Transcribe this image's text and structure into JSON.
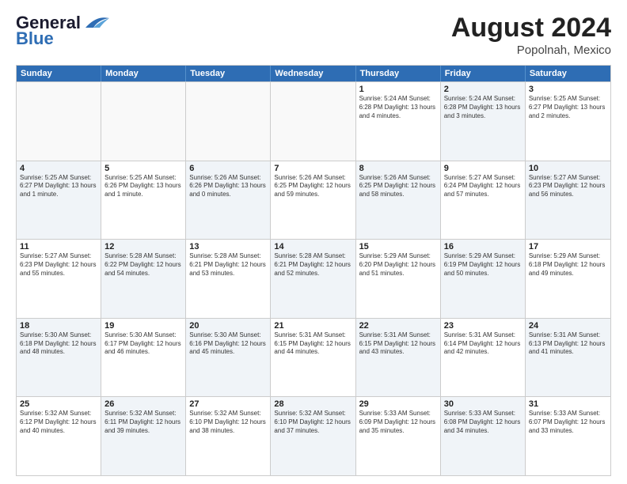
{
  "header": {
    "logo_general": "General",
    "logo_blue": "Blue",
    "month_year": "August 2024",
    "location": "Popolnah, Mexico"
  },
  "weekdays": [
    "Sunday",
    "Monday",
    "Tuesday",
    "Wednesday",
    "Thursday",
    "Friday",
    "Saturday"
  ],
  "rows": [
    [
      {
        "day": "",
        "info": "",
        "shaded": false,
        "empty": true
      },
      {
        "day": "",
        "info": "",
        "shaded": false,
        "empty": true
      },
      {
        "day": "",
        "info": "",
        "shaded": false,
        "empty": true
      },
      {
        "day": "",
        "info": "",
        "shaded": false,
        "empty": true
      },
      {
        "day": "1",
        "info": "Sunrise: 5:24 AM\nSunset: 6:28 PM\nDaylight: 13 hours\nand 4 minutes.",
        "shaded": false,
        "empty": false
      },
      {
        "day": "2",
        "info": "Sunrise: 5:24 AM\nSunset: 6:28 PM\nDaylight: 13 hours\nand 3 minutes.",
        "shaded": true,
        "empty": false
      },
      {
        "day": "3",
        "info": "Sunrise: 5:25 AM\nSunset: 6:27 PM\nDaylight: 13 hours\nand 2 minutes.",
        "shaded": false,
        "empty": false
      }
    ],
    [
      {
        "day": "4",
        "info": "Sunrise: 5:25 AM\nSunset: 6:27 PM\nDaylight: 13 hours\nand 1 minute.",
        "shaded": true,
        "empty": false
      },
      {
        "day": "5",
        "info": "Sunrise: 5:25 AM\nSunset: 6:26 PM\nDaylight: 13 hours\nand 1 minute.",
        "shaded": false,
        "empty": false
      },
      {
        "day": "6",
        "info": "Sunrise: 5:26 AM\nSunset: 6:26 PM\nDaylight: 13 hours\nand 0 minutes.",
        "shaded": true,
        "empty": false
      },
      {
        "day": "7",
        "info": "Sunrise: 5:26 AM\nSunset: 6:25 PM\nDaylight: 12 hours\nand 59 minutes.",
        "shaded": false,
        "empty": false
      },
      {
        "day": "8",
        "info": "Sunrise: 5:26 AM\nSunset: 6:25 PM\nDaylight: 12 hours\nand 58 minutes.",
        "shaded": true,
        "empty": false
      },
      {
        "day": "9",
        "info": "Sunrise: 5:27 AM\nSunset: 6:24 PM\nDaylight: 12 hours\nand 57 minutes.",
        "shaded": false,
        "empty": false
      },
      {
        "day": "10",
        "info": "Sunrise: 5:27 AM\nSunset: 6:23 PM\nDaylight: 12 hours\nand 56 minutes.",
        "shaded": true,
        "empty": false
      }
    ],
    [
      {
        "day": "11",
        "info": "Sunrise: 5:27 AM\nSunset: 6:23 PM\nDaylight: 12 hours\nand 55 minutes.",
        "shaded": false,
        "empty": false
      },
      {
        "day": "12",
        "info": "Sunrise: 5:28 AM\nSunset: 6:22 PM\nDaylight: 12 hours\nand 54 minutes.",
        "shaded": true,
        "empty": false
      },
      {
        "day": "13",
        "info": "Sunrise: 5:28 AM\nSunset: 6:21 PM\nDaylight: 12 hours\nand 53 minutes.",
        "shaded": false,
        "empty": false
      },
      {
        "day": "14",
        "info": "Sunrise: 5:28 AM\nSunset: 6:21 PM\nDaylight: 12 hours\nand 52 minutes.",
        "shaded": true,
        "empty": false
      },
      {
        "day": "15",
        "info": "Sunrise: 5:29 AM\nSunset: 6:20 PM\nDaylight: 12 hours\nand 51 minutes.",
        "shaded": false,
        "empty": false
      },
      {
        "day": "16",
        "info": "Sunrise: 5:29 AM\nSunset: 6:19 PM\nDaylight: 12 hours\nand 50 minutes.",
        "shaded": true,
        "empty": false
      },
      {
        "day": "17",
        "info": "Sunrise: 5:29 AM\nSunset: 6:18 PM\nDaylight: 12 hours\nand 49 minutes.",
        "shaded": false,
        "empty": false
      }
    ],
    [
      {
        "day": "18",
        "info": "Sunrise: 5:30 AM\nSunset: 6:18 PM\nDaylight: 12 hours\nand 48 minutes.",
        "shaded": true,
        "empty": false
      },
      {
        "day": "19",
        "info": "Sunrise: 5:30 AM\nSunset: 6:17 PM\nDaylight: 12 hours\nand 46 minutes.",
        "shaded": false,
        "empty": false
      },
      {
        "day": "20",
        "info": "Sunrise: 5:30 AM\nSunset: 6:16 PM\nDaylight: 12 hours\nand 45 minutes.",
        "shaded": true,
        "empty": false
      },
      {
        "day": "21",
        "info": "Sunrise: 5:31 AM\nSunset: 6:15 PM\nDaylight: 12 hours\nand 44 minutes.",
        "shaded": false,
        "empty": false
      },
      {
        "day": "22",
        "info": "Sunrise: 5:31 AM\nSunset: 6:15 PM\nDaylight: 12 hours\nand 43 minutes.",
        "shaded": true,
        "empty": false
      },
      {
        "day": "23",
        "info": "Sunrise: 5:31 AM\nSunset: 6:14 PM\nDaylight: 12 hours\nand 42 minutes.",
        "shaded": false,
        "empty": false
      },
      {
        "day": "24",
        "info": "Sunrise: 5:31 AM\nSunset: 6:13 PM\nDaylight: 12 hours\nand 41 minutes.",
        "shaded": true,
        "empty": false
      }
    ],
    [
      {
        "day": "25",
        "info": "Sunrise: 5:32 AM\nSunset: 6:12 PM\nDaylight: 12 hours\nand 40 minutes.",
        "shaded": false,
        "empty": false
      },
      {
        "day": "26",
        "info": "Sunrise: 5:32 AM\nSunset: 6:11 PM\nDaylight: 12 hours\nand 39 minutes.",
        "shaded": true,
        "empty": false
      },
      {
        "day": "27",
        "info": "Sunrise: 5:32 AM\nSunset: 6:10 PM\nDaylight: 12 hours\nand 38 minutes.",
        "shaded": false,
        "empty": false
      },
      {
        "day": "28",
        "info": "Sunrise: 5:32 AM\nSunset: 6:10 PM\nDaylight: 12 hours\nand 37 minutes.",
        "shaded": true,
        "empty": false
      },
      {
        "day": "29",
        "info": "Sunrise: 5:33 AM\nSunset: 6:09 PM\nDaylight: 12 hours\nand 35 minutes.",
        "shaded": false,
        "empty": false
      },
      {
        "day": "30",
        "info": "Sunrise: 5:33 AM\nSunset: 6:08 PM\nDaylight: 12 hours\nand 34 minutes.",
        "shaded": true,
        "empty": false
      },
      {
        "day": "31",
        "info": "Sunrise: 5:33 AM\nSunset: 6:07 PM\nDaylight: 12 hours\nand 33 minutes.",
        "shaded": false,
        "empty": false
      }
    ]
  ]
}
